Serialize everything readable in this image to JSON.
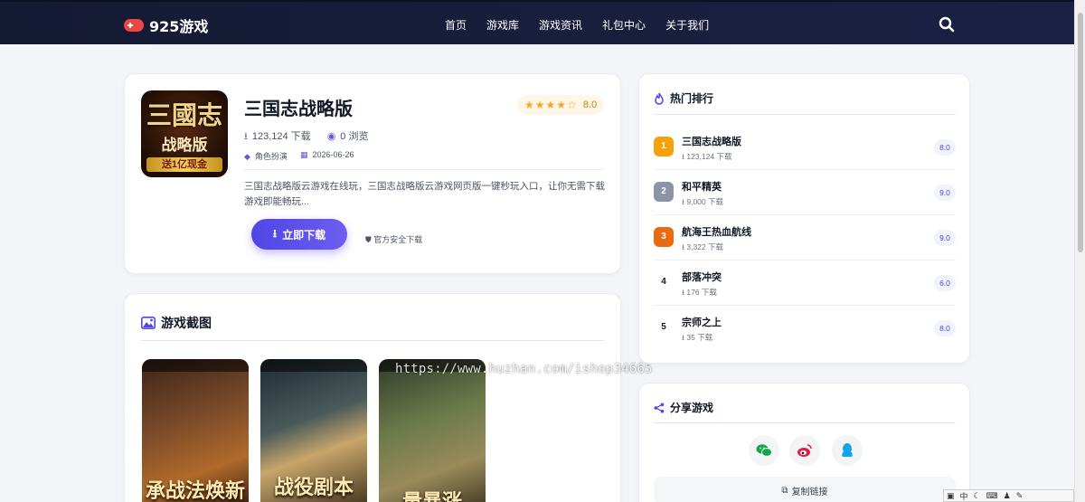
{
  "nav": {
    "brand": "925游戏",
    "items": [
      "首页",
      "游戏库",
      "游戏资讯",
      "礼包中心",
      "关于我们"
    ]
  },
  "game": {
    "cover": {
      "big": "三國志",
      "mid": "战略版",
      "ribbon": "送1亿现金"
    },
    "title": "三国志战略版",
    "rating": "8.0",
    "rating_value": 4.5,
    "downloads": "123,124 下载",
    "views": "0 浏览",
    "category": "角色扮演",
    "date": "2026-06-26",
    "description": "三国志战略版云游戏在线玩，三国志战略版云游戏网页版一键秒玩入口，让你无需下载游戏即能畅玩...",
    "download_label": "立即下载",
    "safe_label": "官方安全下载"
  },
  "screenshots": {
    "title": "游戏截图",
    "captions": [
      "承战法焕新",
      "战役剧本",
      "量暴涨"
    ],
    "watermark": "https://www.huzhan.com/ishop34665"
  },
  "hot": {
    "title": "热门排行",
    "items": [
      {
        "rank": "1",
        "name": "三国志战略版",
        "downloads": "123,124 下载",
        "score": "8.0",
        "color": "#f5a20a"
      },
      {
        "rank": "2",
        "name": "和平精英",
        "downloads": "9,000 下载",
        "score": "9.0",
        "color": "#8a93a8"
      },
      {
        "rank": "3",
        "name": "航海王热血航线",
        "downloads": "3,322 下载",
        "score": "9.0",
        "color": "#ea6a12"
      },
      {
        "rank": "4",
        "name": "部落冲突",
        "downloads": "176 下载",
        "score": "6.0",
        "color": ""
      },
      {
        "rank": "5",
        "name": "宗师之上",
        "downloads": "35 下载",
        "score": "8.0",
        "color": ""
      }
    ]
  },
  "share": {
    "title": "分享游戏",
    "copy_label": "复制链接",
    "icons": [
      "wechat-icon",
      "weibo-icon",
      "qq-icon"
    ]
  },
  "ime": {
    "label": "中"
  },
  "colors": {
    "accent": "#4f46e5",
    "nav_bg": "#171c38",
    "star": "#f5a623"
  }
}
